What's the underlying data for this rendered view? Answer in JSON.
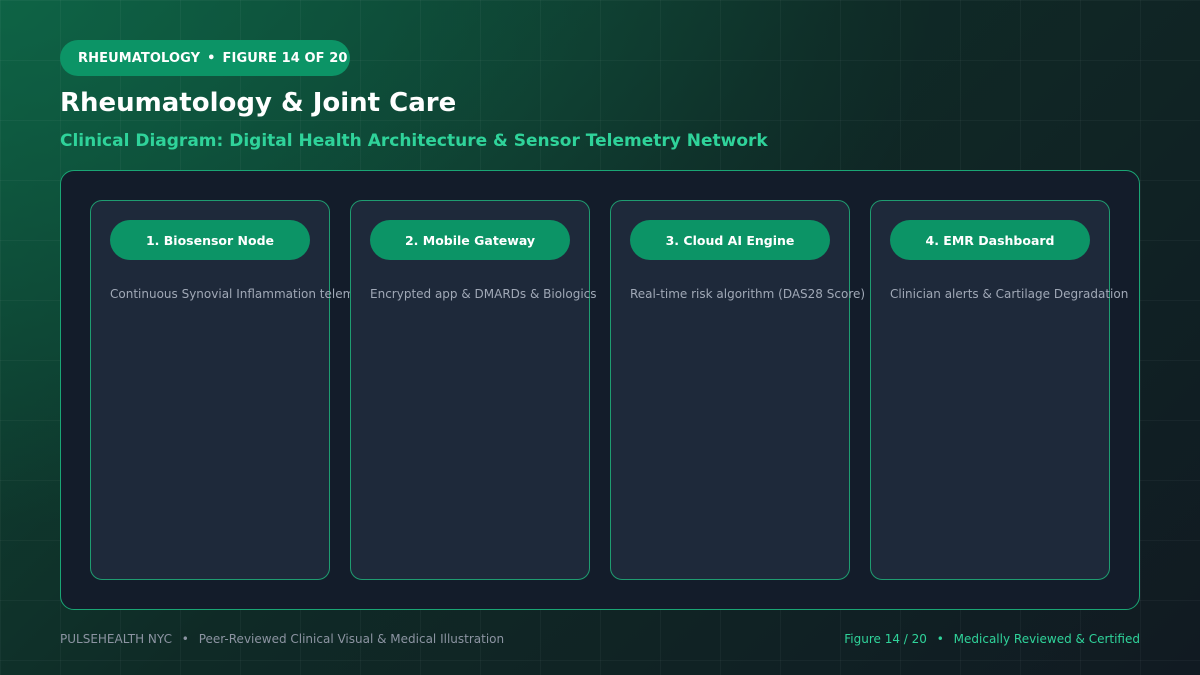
{
  "header": {
    "specialty": "RHEUMATOLOGY",
    "separator": "•",
    "figure_label": "FIGURE 14 OF 20"
  },
  "title": "Rheumatology & Joint Care",
  "subtitle": "Clinical Diagram: Digital Health Architecture & Sensor Telemetry Network",
  "nodes": [
    {
      "title": "1. Biosensor Node",
      "description": "Continuous Synovial Inflammation telemetry"
    },
    {
      "title": "2. Mobile Gateway",
      "description": "Encrypted app & DMARDs & Biologics"
    },
    {
      "title": "3. Cloud AI Engine",
      "description": "Real-time risk algorithm (DAS28 Score)"
    },
    {
      "title": "4. EMR Dashboard",
      "description": "Clinician alerts & Cartilage Degradation"
    }
  ],
  "footer": {
    "brand": "PULSEHEALTH NYC",
    "separator": "•",
    "tagline": "Peer-Reviewed Clinical Visual & Medical Illustration",
    "figure": "Figure 14 / 20",
    "status": "Medically Reviewed & Certified"
  },
  "colors": {
    "accent": "#0c9466",
    "accent_text": "#2fd39a",
    "panel_bg": "#131c2a",
    "card_bg": "#1e293a"
  }
}
